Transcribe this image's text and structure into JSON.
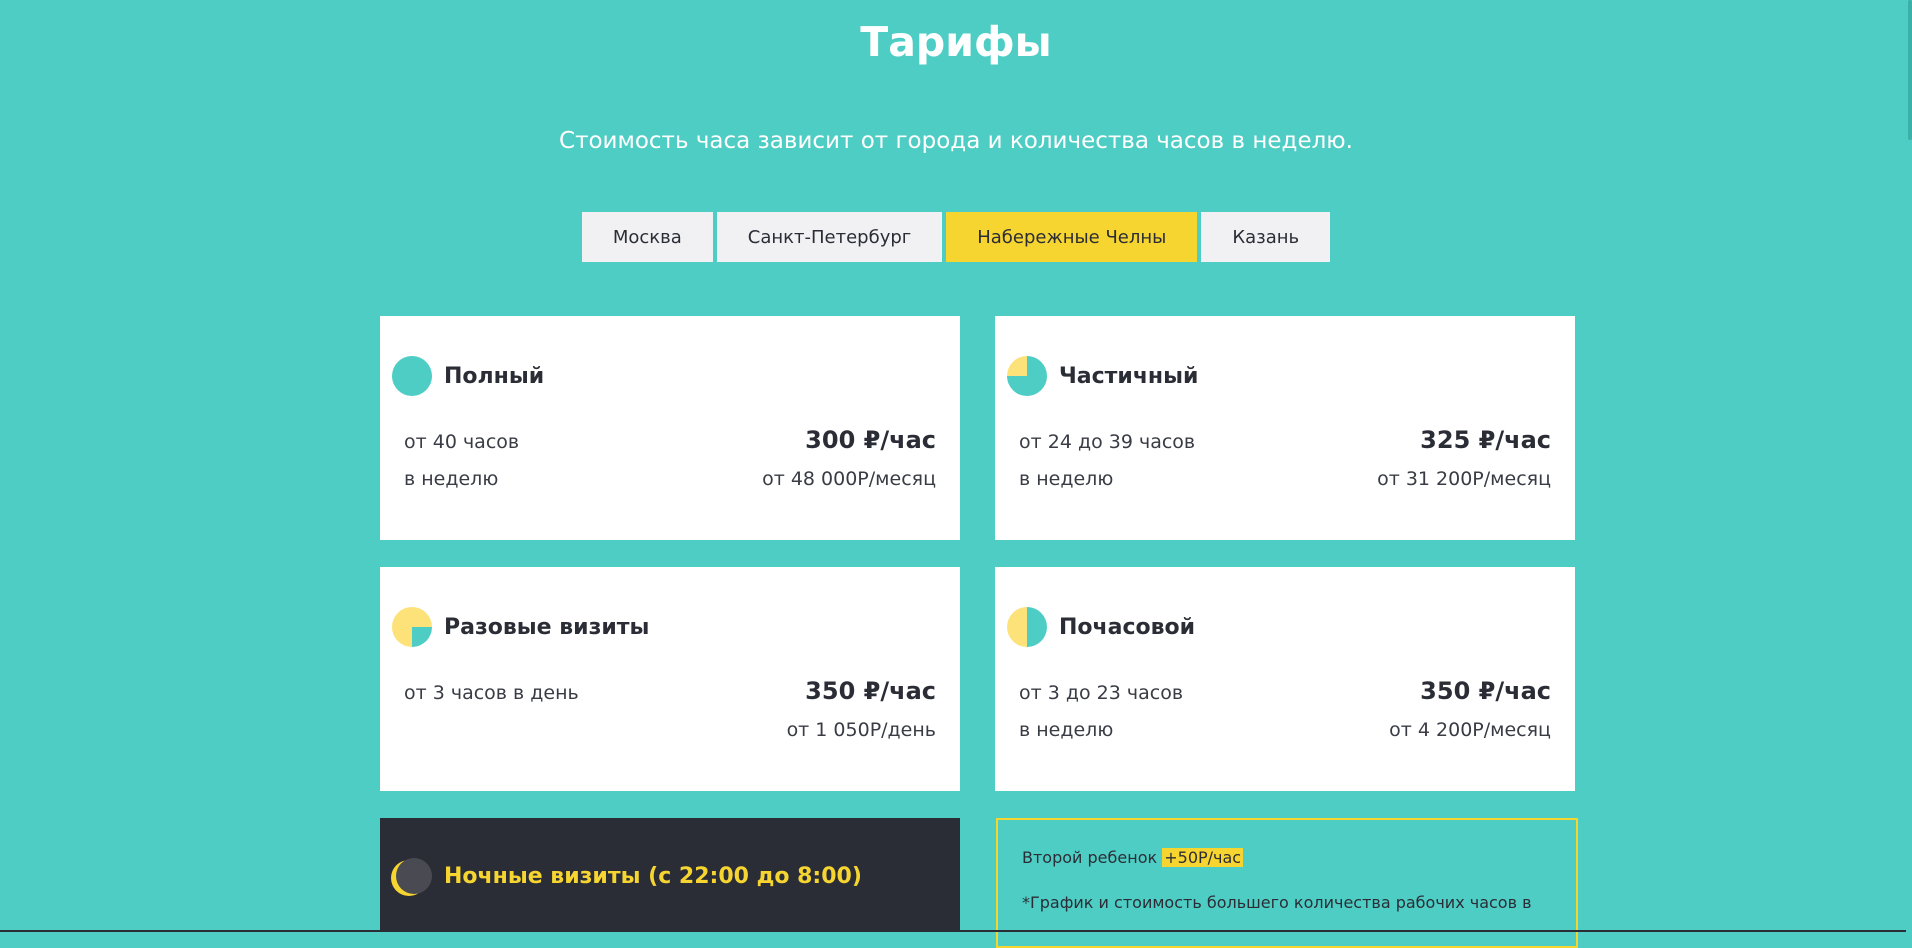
{
  "header": {
    "title": "Тарифы",
    "subtitle": "Стоимость часа зависит от города и количества часов в неделю."
  },
  "city_tabs": [
    {
      "label": "Москва",
      "active": false
    },
    {
      "label": "Санкт-Петербург",
      "active": false
    },
    {
      "label": "Набережные Челны",
      "active": true
    },
    {
      "label": "Казань",
      "active": false
    }
  ],
  "colors": {
    "background": "#4ecdc4",
    "accent": "#f7d531",
    "dark": "#2b2d36",
    "card": "#ffffff"
  },
  "cards": [
    {
      "icon": "full-pie-icon",
      "title": "Полный",
      "line1_left": "от 40 часов",
      "line2_left": "в неделю",
      "price": "300 ₽/час",
      "total": "от 48 000Р/месяц"
    },
    {
      "icon": "three-quarter-pie-icon",
      "title": "Частичный",
      "line1_left": "от 24 до 39 часов",
      "line2_left": "в неделю",
      "price": "325 ₽/час",
      "total": "от 31 200Р/месяц"
    },
    {
      "icon": "quarter-pie-icon",
      "title": "Разовые визиты",
      "line1_left": "от 3 часов в день",
      "line2_left": "",
      "price": "350 ₽/час",
      "total": "от 1 050Р/день"
    },
    {
      "icon": "half-pie-icon",
      "title": "Почасовой",
      "line1_left": "от 3 до 23 часов",
      "line2_left": "в неделю",
      "price": "350 ₽/час",
      "total": "от 4 200Р/месяц"
    },
    {
      "icon": "moon-icon",
      "title": "Ночные визиты (с 22:00 до 8:00)"
    }
  ],
  "info": {
    "second_child_text": "Второй ребенок ",
    "second_child_highlight": "+50Р/час",
    "note": "*График и стоимость большего количества рабочих часов в"
  }
}
